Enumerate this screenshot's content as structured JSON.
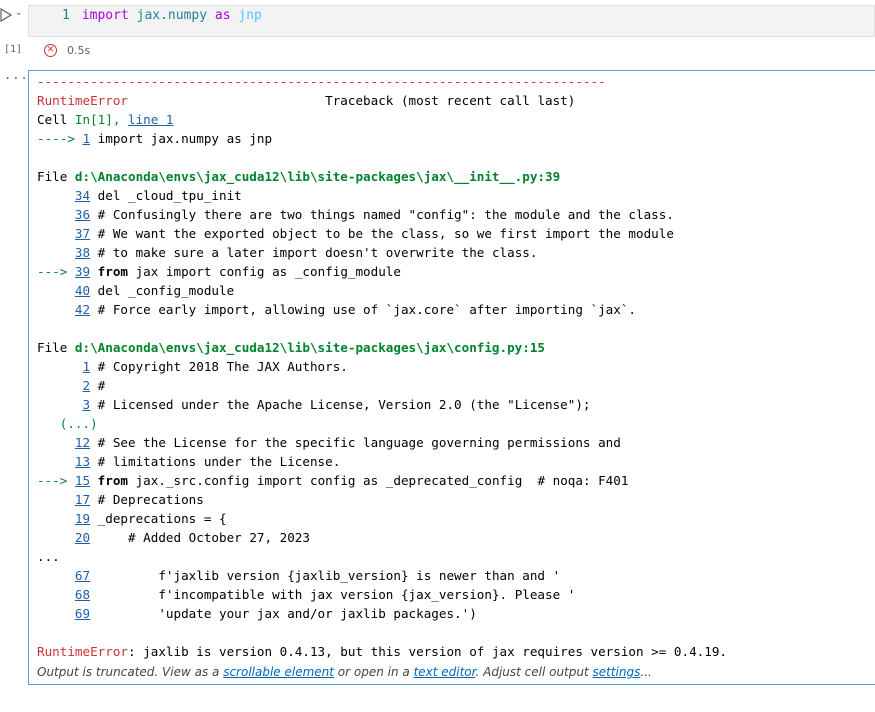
{
  "cell": {
    "execution_count": "[1]",
    "line_number": "1",
    "code": {
      "kw1": "import",
      "module": " jax.numpy ",
      "kw2": "as",
      "alias": " jnp"
    },
    "exec_time": "0.5s",
    "status_icon": "error-circle-icon",
    "output_dots": "..."
  },
  "traceback": {
    "dashes": "---------------------------------------------------------------------------",
    "error_type": "RuntimeError",
    "header_right": "Traceback (most recent call last)",
    "cell_prefix": "Cell ",
    "cell_ref": "In[1]",
    "cell_sep": ", ",
    "cell_line": "line 1",
    "cell_arrow": "----> ",
    "cell_arrow_no": "1",
    "cell_arrow_code": " import jax.numpy as jnp",
    "frames": [
      {
        "file_prefix": "File ",
        "file_path": "d:\\Anaconda\\envs\\jax_cuda12\\lib\\site-packages\\jax\\__init__.py:39",
        "lines": [
          {
            "prefix": "     ",
            "no": "34",
            "code": " del _cloud_tpu_init"
          },
          {
            "prefix": "     ",
            "no": "36",
            "code": " # Confusingly there are two things named \"config\": the module and the class."
          },
          {
            "prefix": "     ",
            "no": "37",
            "code": " # We want the exported object to be the class, so we first import the module"
          },
          {
            "prefix": "     ",
            "no": "38",
            "code": " # to make sure a later import doesn't overwrite the class."
          },
          {
            "prefix": "---> ",
            "no": "39",
            "code_kw": " from",
            "code": " jax import config as _config_module",
            "active": true
          },
          {
            "prefix": "     ",
            "no": "40",
            "code": " del _config_module"
          },
          {
            "prefix": "     ",
            "no": "42",
            "code": " # Force early import, allowing use of `jax.core` after importing `jax`."
          }
        ]
      },
      {
        "file_prefix": "File ",
        "file_path": "d:\\Anaconda\\envs\\jax_cuda12\\lib\\site-packages\\jax\\config.py:15",
        "lines": [
          {
            "prefix": "      ",
            "no": "1",
            "code": " # Copyright 2018 The JAX Authors."
          },
          {
            "prefix": "      ",
            "no": "2",
            "code": " #"
          },
          {
            "prefix": "      ",
            "no": "3",
            "code": " # Licensed under the Apache License, Version 2.0 (the \"License\");"
          },
          {
            "ellipsis": "   (...)"
          },
          {
            "prefix": "     ",
            "no": "12",
            "code": " # See the License for the specific language governing permissions and"
          },
          {
            "prefix": "     ",
            "no": "13",
            "code": " # limitations under the License."
          },
          {
            "prefix": "---> ",
            "no": "15",
            "code_kw": " from",
            "code": " jax._src.config import config as _deprecated_config  # noqa: F401",
            "active": true
          },
          {
            "prefix": "     ",
            "no": "17",
            "code": " # Deprecations"
          },
          {
            "prefix": "     ",
            "no": "19",
            "code": " _deprecations = {"
          },
          {
            "prefix": "     ",
            "no": "20",
            "code": "     # Added October 27, 2023"
          }
        ]
      }
    ],
    "mid_ellipsis": "...",
    "tail_lines": [
      {
        "prefix": "     ",
        "no": "67",
        "code": "         f'jaxlib version {jaxlib_version} is newer than and '"
      },
      {
        "prefix": "     ",
        "no": "68",
        "code": "         f'incompatible with jax version {jax_version}. Please '"
      },
      {
        "prefix": "     ",
        "no": "69",
        "code": "         'update your jax and/or jaxlib packages.')"
      }
    ],
    "final_error_type": "RuntimeError",
    "final_message": ": jaxlib is version 0.4.13, but this version of jax requires version >= 0.4.19."
  },
  "footer": {
    "text1": "Output is truncated. View as a ",
    "link1": "scrollable element",
    "text2": " or open in a ",
    "link2": "text editor",
    "text3": ". Adjust cell output ",
    "link3": "settings",
    "text4": "..."
  },
  "colors": {
    "error": "#cd3131",
    "path": "#00832d",
    "link": "#0066b8",
    "output_border": "#5e9fd4"
  }
}
